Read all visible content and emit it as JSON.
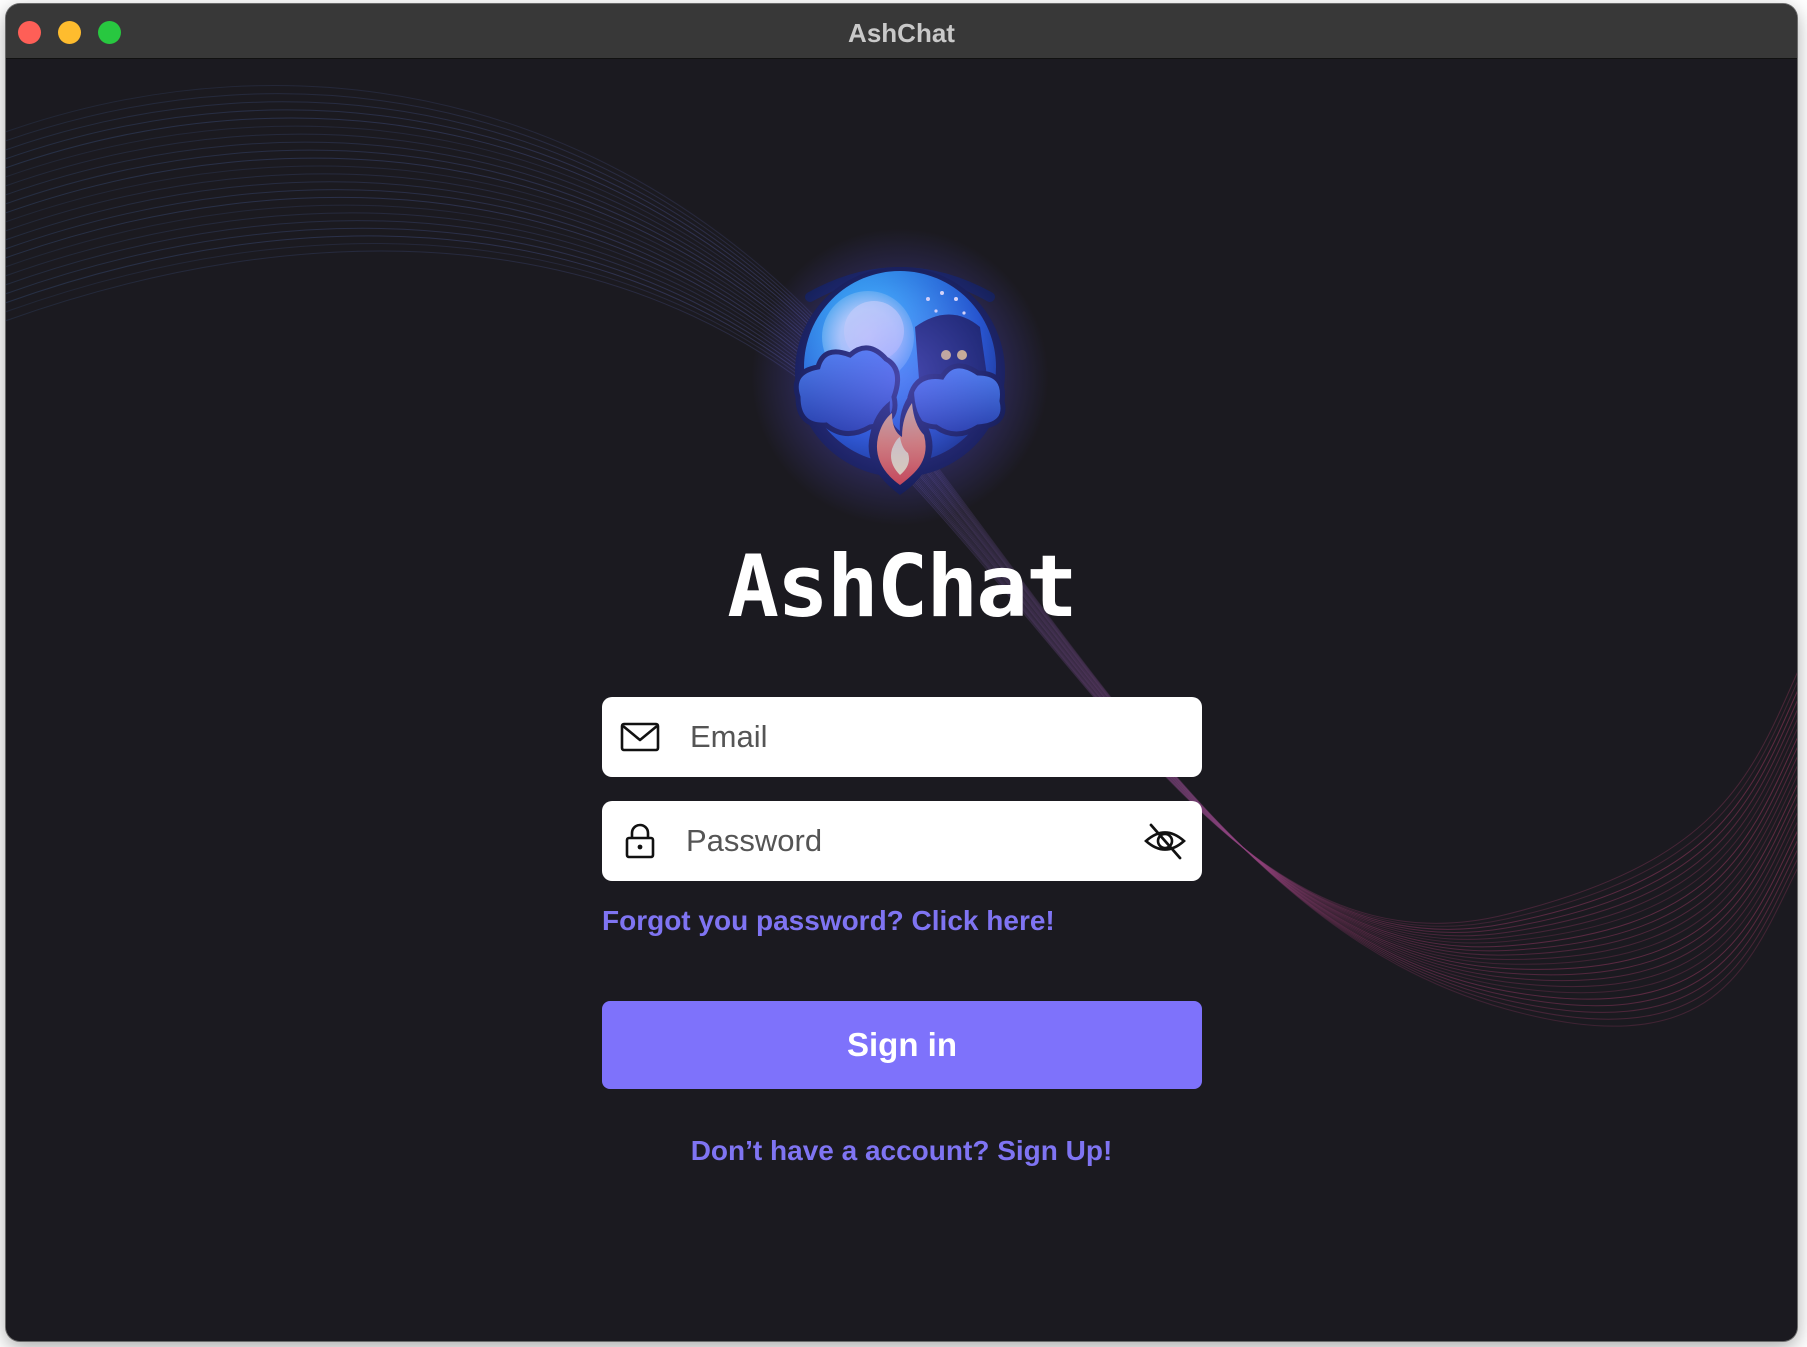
{
  "window": {
    "title": "AshChat"
  },
  "brand": {
    "name": "AshChat"
  },
  "form": {
    "email_placeholder": "Email",
    "password_placeholder": "Password",
    "forgot_password_link": "Forgot you password? Click here!",
    "sign_in_label": "Sign in",
    "sign_up_link": "Don’t have a account? Sign Up!"
  },
  "icons": {
    "email": "envelope-icon",
    "password": "lock-icon",
    "toggle_visibility": "eye-off-icon"
  },
  "colors": {
    "background": "#1b1a20",
    "accent": "#7e72fb",
    "link": "#7f74f2",
    "field_background": "#ffffff"
  }
}
